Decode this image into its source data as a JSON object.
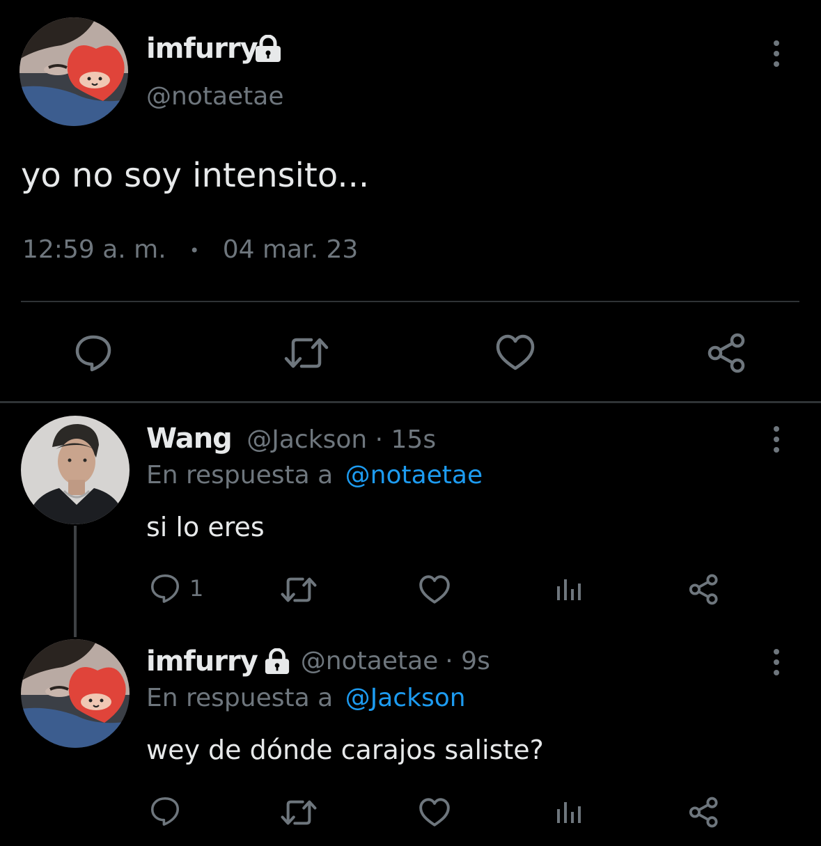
{
  "main_tweet": {
    "display_name": "imfurry",
    "handle": "@notaetae",
    "text": "yo no soy intensito...",
    "time": "12:59 a. m.",
    "separator": "•",
    "date": "04 mar. 23",
    "icons": [
      "lock-icon",
      "more-icon",
      "reply-icon",
      "retweet-icon",
      "like-icon",
      "share-icon"
    ]
  },
  "reply_1": {
    "display_name": "Wang",
    "handle": "@Jackson",
    "age": "· 15s",
    "reply_prefix": "En respuesta a",
    "reply_to": "@notaetae",
    "text": "si lo eres",
    "reply_count": "1"
  },
  "reply_2": {
    "display_name": "imfurry",
    "handle": "@notaetae",
    "age": "· 9s",
    "reply_prefix": "En respuesta a",
    "reply_to": "@Jackson",
    "text": "wey de dónde carajos saliste?"
  },
  "colors": {
    "background": "#000000",
    "text": "#e7e9ea",
    "secondary": "#6e767d",
    "link": "#1d9bf0",
    "divider": "#2f3336"
  }
}
